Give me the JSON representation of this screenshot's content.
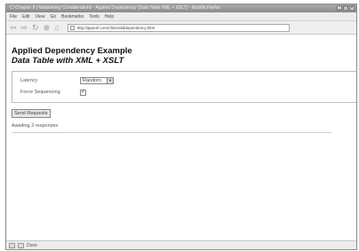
{
  "window": {
    "title": "C:\\Chapter 8 | Networking Considerations - Applied Dependency (Data Table XML + XSLT) - Mozilla Firefox"
  },
  "menubar": {
    "items": [
      "File",
      "Edit",
      "View",
      "Go",
      "Bookmarks",
      "Tools",
      "Help"
    ]
  },
  "navbar": {
    "url": "http://ajaxref.com/ch6/validdependency.html"
  },
  "page": {
    "title": "Applied Dependency Example",
    "subtitle": "Data Table with XML + XSLT"
  },
  "form": {
    "latency_label": "Latency",
    "latency_value": "Random",
    "force_sequencing_label": "Force Sequencing",
    "force_sequencing_checked": true,
    "send_button": "Send Requests"
  },
  "status": {
    "message": "Awaiting 2 responses",
    "statusbar_text": "Done"
  }
}
